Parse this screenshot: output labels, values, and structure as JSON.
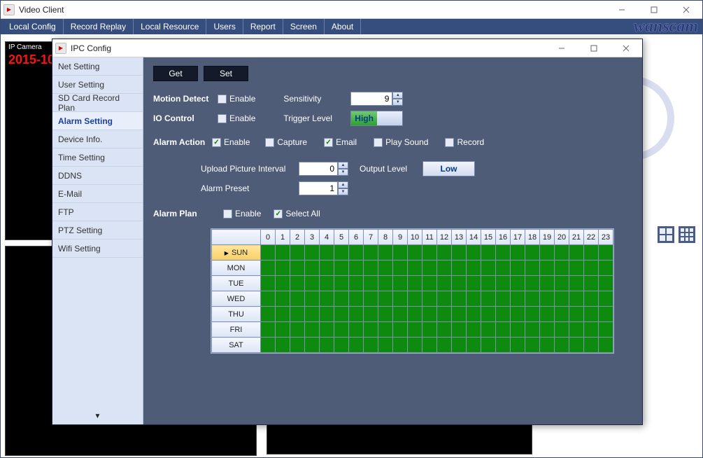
{
  "app": {
    "title": "Video Client",
    "menu": [
      "Local Config",
      "Record Replay",
      "Local Resource",
      "Users",
      "Report",
      "Screen",
      "About"
    ],
    "brand": "wanscam",
    "cam_label": "IP Camera",
    "timestamp": "2015-10"
  },
  "dlg": {
    "title": "IPC Config",
    "side_items": [
      "Net Setting",
      "User Setting",
      "SD Card Record Plan",
      "Alarm Setting",
      "Device Info.",
      "Time Setting",
      "DDNS",
      "E-Mail",
      "FTP",
      "PTZ Setting",
      "Wifi Setting"
    ],
    "side_active_index": 3,
    "buttons": {
      "get": "Get",
      "set": "Set"
    },
    "motion": {
      "section_label": "Motion Detect",
      "enable_label": "Enable",
      "enable_checked": false,
      "sensitivity_label": "Sensitivity",
      "sensitivity_value": "9"
    },
    "io": {
      "section_label": "IO Control",
      "enable_label": "Enable",
      "enable_checked": false,
      "trigger_label": "Trigger Level",
      "trigger_value": "High"
    },
    "alarm_action": {
      "section_label": "Alarm Action",
      "enable_label": "Enable",
      "enable_checked": true,
      "opts": [
        {
          "label": "Capture",
          "checked": false
        },
        {
          "label": "Email",
          "checked": true
        },
        {
          "label": "Play Sound",
          "checked": false
        },
        {
          "label": "Record",
          "checked": false
        }
      ],
      "upload_label": "Upload Picture Interval",
      "upload_value": "0",
      "output_label": "Output Level",
      "output_value": "Low",
      "preset_label": "Alarm Preset",
      "preset_value": "1"
    },
    "alarm_plan": {
      "section_label": "Alarm Plan",
      "enable_label": "Enable",
      "enable_checked": false,
      "selectall_label": "Select All",
      "selectall_checked": true,
      "hours": [
        "0",
        "1",
        "2",
        "3",
        "4",
        "5",
        "6",
        "7",
        "8",
        "9",
        "10",
        "11",
        "12",
        "13",
        "14",
        "15",
        "16",
        "17",
        "18",
        "19",
        "20",
        "21",
        "22",
        "23"
      ],
      "days": [
        "SUN",
        "MON",
        "TUE",
        "WED",
        "THU",
        "FRI",
        "SAT"
      ],
      "selected_day_index": 0
    }
  }
}
